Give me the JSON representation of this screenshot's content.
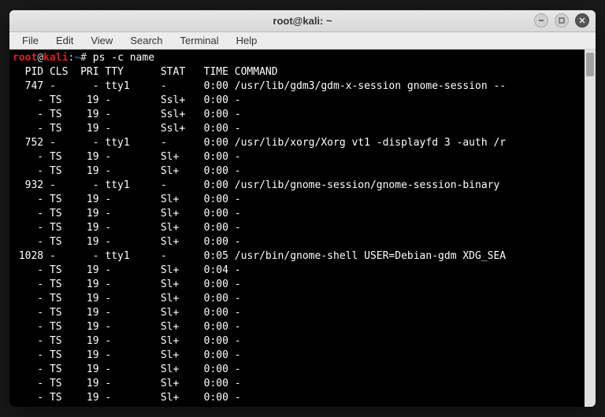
{
  "window": {
    "title": "root@kali: ~"
  },
  "menubar": {
    "items": [
      "File",
      "Edit",
      "View",
      "Search",
      "Terminal",
      "Help"
    ]
  },
  "prompt": {
    "user": "root",
    "at": "@",
    "host": "kali",
    "colon": ":",
    "path": "~",
    "hash": "#",
    "command": "ps -c name"
  },
  "header": "  PID CLS  PRI TTY      STAT   TIME COMMAND",
  "rows": [
    "  747 -      - tty1     -      0:00 /usr/lib/gdm3/gdm-x-session gnome-session --",
    "    - TS    19 -        Ssl+   0:00 -",
    "    - TS    19 -        Ssl+   0:00 -",
    "    - TS    19 -        Ssl+   0:00 -",
    "  752 -      - tty1     -      0:00 /usr/lib/xorg/Xorg vt1 -displayfd 3 -auth /r",
    "    - TS    19 -        Sl+    0:00 -",
    "    - TS    19 -        Sl+    0:00 -",
    "  932 -      - tty1     -      0:00 /usr/lib/gnome-session/gnome-session-binary ",
    "    - TS    19 -        Sl+    0:00 -",
    "    - TS    19 -        Sl+    0:00 -",
    "    - TS    19 -        Sl+    0:00 -",
    "    - TS    19 -        Sl+    0:00 -",
    " 1028 -      - tty1     -      0:05 /usr/bin/gnome-shell USER=Debian-gdm XDG_SEA",
    "    - TS    19 -        Sl+    0:04 -",
    "    - TS    19 -        Sl+    0:00 -",
    "    - TS    19 -        Sl+    0:00 -",
    "    - TS    19 -        Sl+    0:00 -",
    "    - TS    19 -        Sl+    0:00 -",
    "    - TS    19 -        Sl+    0:00 -",
    "    - TS    19 -        Sl+    0:00 -",
    "    - TS    19 -        Sl+    0:00 -",
    "    - TS    19 -        Sl+    0:00 -",
    "    - TS    19 -        Sl+    0:00 -"
  ]
}
